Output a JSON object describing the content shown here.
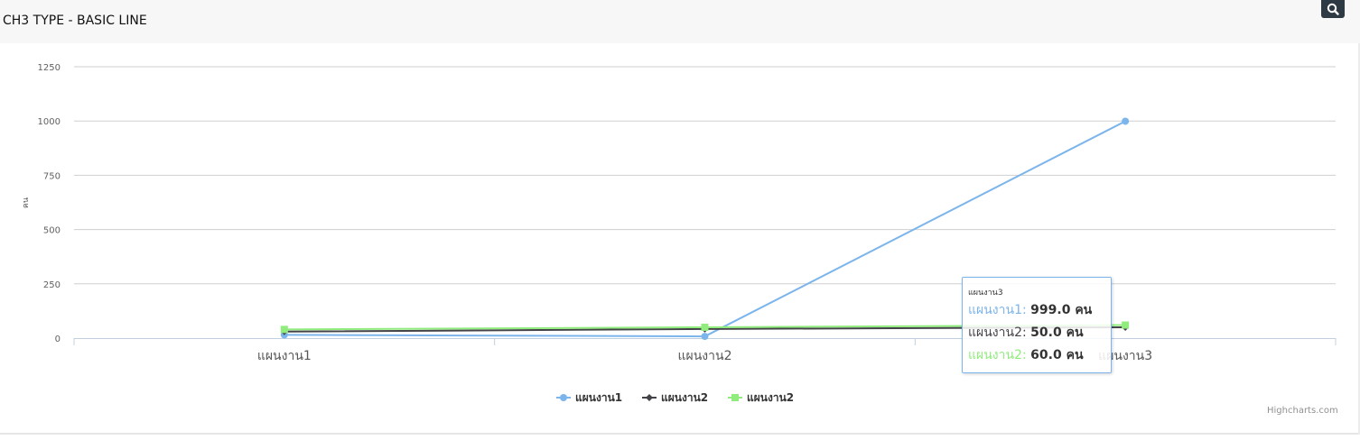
{
  "header": {
    "title": "CH3 TYPE - BASIC LINE",
    "zoom_icon": "search-icon"
  },
  "chart_data": {
    "type": "line",
    "categories": [
      "แผนงาน1",
      "แผนงาน2",
      "แผนงาน3"
    ],
    "ylabel": "คน",
    "ylim": [
      0,
      1250
    ],
    "yticks": [
      0,
      250,
      500,
      750,
      1000,
      1250
    ],
    "grid": true,
    "legend_placement": "bottom-center",
    "series": [
      {
        "name": "แผนงาน1",
        "values": [
          15,
          8,
          999
        ],
        "color": "#7cb5ec",
        "marker": "circle"
      },
      {
        "name": "แผนงาน2",
        "values": [
          30,
          42,
          50
        ],
        "color": "#434348",
        "marker": "diamond"
      },
      {
        "name": "แผนงาน2",
        "values": [
          40,
          50,
          60
        ],
        "color": "#90ed7d",
        "marker": "square"
      }
    ]
  },
  "tooltip": {
    "header": "แผนงาน3",
    "rows": [
      {
        "name": "แผนงาน1",
        "value": "999.0 คน",
        "color": "#7cb5ec"
      },
      {
        "name": "แผนงาน2",
        "value": "50.0 คน",
        "color": "#434348"
      },
      {
        "name": "แผนงาน2",
        "value": "60.0 คน",
        "color": "#90ed7d"
      }
    ]
  },
  "credits": "Highcharts.com"
}
